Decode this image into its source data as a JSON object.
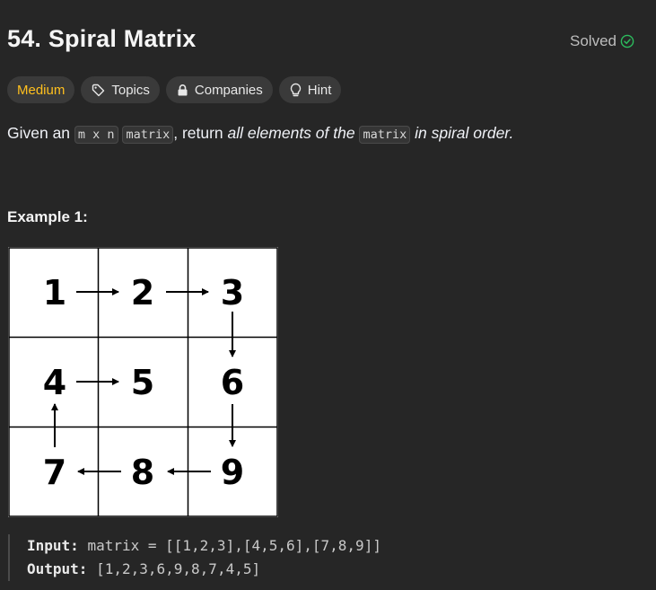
{
  "problem": {
    "title": "54. Spiral Matrix",
    "status": "Solved"
  },
  "tags": {
    "difficulty": "Medium",
    "topics": "Topics",
    "companies": "Companies",
    "hint": "Hint"
  },
  "description": {
    "given": "Given an",
    "code1": "m x n",
    "code2": "matrix",
    "middle": ", return",
    "italic": "all elements of the",
    "code3": "matrix",
    "end": "in spiral order."
  },
  "example": {
    "title": "Example 1:",
    "input_label": "Input:",
    "input_value": "matrix = [[1,2,3],[4,5,6],[7,8,9]]",
    "output_label": "Output:",
    "output_value": "[1,2,3,6,9,8,7,4,5]"
  },
  "figure": {
    "cells": [
      "1",
      "2",
      "3",
      "4",
      "5",
      "6",
      "7",
      "8",
      "9"
    ]
  },
  "colors": {
    "background": "#262626",
    "medium": "#ffc01e",
    "solved_check": "#2cbb5d",
    "tag_bg": "#3a3a3a"
  },
  "icons": {
    "solved": "check-circle-icon",
    "topics": "tag-icon",
    "companies": "lock-icon",
    "hint": "lightbulb-icon"
  }
}
